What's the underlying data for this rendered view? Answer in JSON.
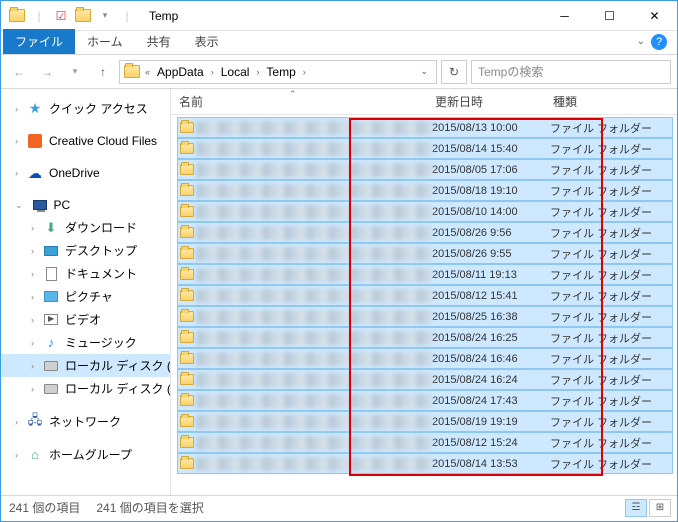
{
  "titlebar": {
    "title": "Temp",
    "qat_sep": "|"
  },
  "ribbon": {
    "file": "ファイル",
    "home": "ホーム",
    "share": "共有",
    "view": "表示"
  },
  "nav": {
    "breadcrumbs": [
      "AppData",
      "Local",
      "Temp"
    ],
    "search_placeholder": "Tempの検索"
  },
  "sidebar": {
    "quick": "クイック アクセス",
    "cc": "Creative Cloud Files",
    "onedrive": "OneDrive",
    "pc": "PC",
    "download": "ダウンロード",
    "desktop": "デスクトップ",
    "documents": "ドキュメント",
    "pictures": "ピクチャ",
    "videos": "ビデオ",
    "music": "ミュージック",
    "disk_c": "ローカル ディスク (C:)",
    "disk_e": "ローカル ディスク (E:)",
    "network": "ネットワーク",
    "homegroup": "ホームグループ"
  },
  "columns": {
    "name": "名前",
    "date": "更新日時",
    "type": "種類"
  },
  "files": [
    {
      "date": "2015/08/13 10:00",
      "type": "ファイル フォルダー"
    },
    {
      "date": "2015/08/14 15:40",
      "type": "ファイル フォルダー"
    },
    {
      "date": "2015/08/05 17:06",
      "type": "ファイル フォルダー"
    },
    {
      "date": "2015/08/18 19:10",
      "type": "ファイル フォルダー"
    },
    {
      "date": "2015/08/10 14:00",
      "type": "ファイル フォルダー"
    },
    {
      "date": "2015/08/26 9:56",
      "type": "ファイル フォルダー"
    },
    {
      "date": "2015/08/26 9:55",
      "type": "ファイル フォルダー"
    },
    {
      "date": "2015/08/11 19:13",
      "type": "ファイル フォルダー"
    },
    {
      "date": "2015/08/12 15:41",
      "type": "ファイル フォルダー"
    },
    {
      "date": "2015/08/25 16:38",
      "type": "ファイル フォルダー"
    },
    {
      "date": "2015/08/24 16:25",
      "type": "ファイル フォルダー"
    },
    {
      "date": "2015/08/24 16:46",
      "type": "ファイル フォルダー"
    },
    {
      "date": "2015/08/24 16:24",
      "type": "ファイル フォルダー"
    },
    {
      "date": "2015/08/24 17:43",
      "type": "ファイル フォルダー"
    },
    {
      "date": "2015/08/19 19:19",
      "type": "ファイル フォルダー"
    },
    {
      "date": "2015/08/12 15:24",
      "type": "ファイル フォルダー"
    },
    {
      "date": "2015/08/14 13:53",
      "type": "ファイル フォルダー"
    }
  ],
  "status": {
    "count": "241 個の項目",
    "selected": "241 個の項目を選択"
  }
}
